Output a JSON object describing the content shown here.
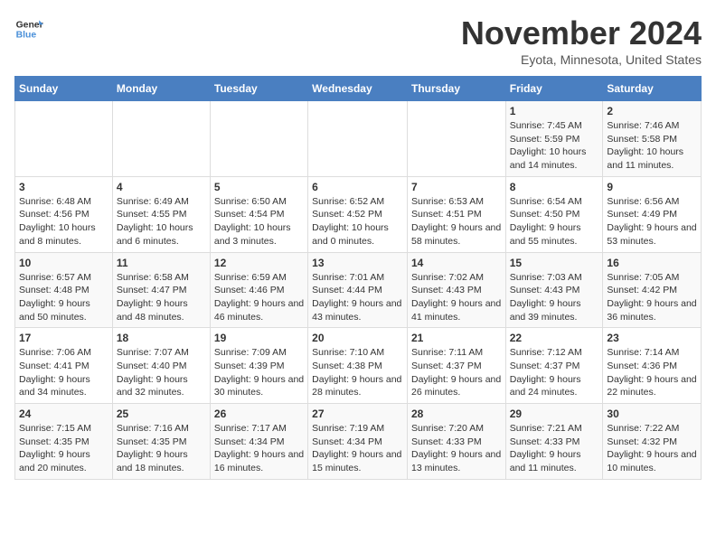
{
  "logo": {
    "general": "General",
    "blue": "Blue"
  },
  "header": {
    "month": "November 2024",
    "location": "Eyota, Minnesota, United States"
  },
  "weekdays": [
    "Sunday",
    "Monday",
    "Tuesday",
    "Wednesday",
    "Thursday",
    "Friday",
    "Saturday"
  ],
  "weeks": [
    [
      {
        "day": "",
        "info": ""
      },
      {
        "day": "",
        "info": ""
      },
      {
        "day": "",
        "info": ""
      },
      {
        "day": "",
        "info": ""
      },
      {
        "day": "",
        "info": ""
      },
      {
        "day": "1",
        "info": "Sunrise: 7:45 AM\nSunset: 5:59 PM\nDaylight: 10 hours and 14 minutes."
      },
      {
        "day": "2",
        "info": "Sunrise: 7:46 AM\nSunset: 5:58 PM\nDaylight: 10 hours and 11 minutes."
      }
    ],
    [
      {
        "day": "3",
        "info": "Sunrise: 6:48 AM\nSunset: 4:56 PM\nDaylight: 10 hours and 8 minutes."
      },
      {
        "day": "4",
        "info": "Sunrise: 6:49 AM\nSunset: 4:55 PM\nDaylight: 10 hours and 6 minutes."
      },
      {
        "day": "5",
        "info": "Sunrise: 6:50 AM\nSunset: 4:54 PM\nDaylight: 10 hours and 3 minutes."
      },
      {
        "day": "6",
        "info": "Sunrise: 6:52 AM\nSunset: 4:52 PM\nDaylight: 10 hours and 0 minutes."
      },
      {
        "day": "7",
        "info": "Sunrise: 6:53 AM\nSunset: 4:51 PM\nDaylight: 9 hours and 58 minutes."
      },
      {
        "day": "8",
        "info": "Sunrise: 6:54 AM\nSunset: 4:50 PM\nDaylight: 9 hours and 55 minutes."
      },
      {
        "day": "9",
        "info": "Sunrise: 6:56 AM\nSunset: 4:49 PM\nDaylight: 9 hours and 53 minutes."
      }
    ],
    [
      {
        "day": "10",
        "info": "Sunrise: 6:57 AM\nSunset: 4:48 PM\nDaylight: 9 hours and 50 minutes."
      },
      {
        "day": "11",
        "info": "Sunrise: 6:58 AM\nSunset: 4:47 PM\nDaylight: 9 hours and 48 minutes."
      },
      {
        "day": "12",
        "info": "Sunrise: 6:59 AM\nSunset: 4:46 PM\nDaylight: 9 hours and 46 minutes."
      },
      {
        "day": "13",
        "info": "Sunrise: 7:01 AM\nSunset: 4:44 PM\nDaylight: 9 hours and 43 minutes."
      },
      {
        "day": "14",
        "info": "Sunrise: 7:02 AM\nSunset: 4:43 PM\nDaylight: 9 hours and 41 minutes."
      },
      {
        "day": "15",
        "info": "Sunrise: 7:03 AM\nSunset: 4:43 PM\nDaylight: 9 hours and 39 minutes."
      },
      {
        "day": "16",
        "info": "Sunrise: 7:05 AM\nSunset: 4:42 PM\nDaylight: 9 hours and 36 minutes."
      }
    ],
    [
      {
        "day": "17",
        "info": "Sunrise: 7:06 AM\nSunset: 4:41 PM\nDaylight: 9 hours and 34 minutes."
      },
      {
        "day": "18",
        "info": "Sunrise: 7:07 AM\nSunset: 4:40 PM\nDaylight: 9 hours and 32 minutes."
      },
      {
        "day": "19",
        "info": "Sunrise: 7:09 AM\nSunset: 4:39 PM\nDaylight: 9 hours and 30 minutes."
      },
      {
        "day": "20",
        "info": "Sunrise: 7:10 AM\nSunset: 4:38 PM\nDaylight: 9 hours and 28 minutes."
      },
      {
        "day": "21",
        "info": "Sunrise: 7:11 AM\nSunset: 4:37 PM\nDaylight: 9 hours and 26 minutes."
      },
      {
        "day": "22",
        "info": "Sunrise: 7:12 AM\nSunset: 4:37 PM\nDaylight: 9 hours and 24 minutes."
      },
      {
        "day": "23",
        "info": "Sunrise: 7:14 AM\nSunset: 4:36 PM\nDaylight: 9 hours and 22 minutes."
      }
    ],
    [
      {
        "day": "24",
        "info": "Sunrise: 7:15 AM\nSunset: 4:35 PM\nDaylight: 9 hours and 20 minutes."
      },
      {
        "day": "25",
        "info": "Sunrise: 7:16 AM\nSunset: 4:35 PM\nDaylight: 9 hours and 18 minutes."
      },
      {
        "day": "26",
        "info": "Sunrise: 7:17 AM\nSunset: 4:34 PM\nDaylight: 9 hours and 16 minutes."
      },
      {
        "day": "27",
        "info": "Sunrise: 7:19 AM\nSunset: 4:34 PM\nDaylight: 9 hours and 15 minutes."
      },
      {
        "day": "28",
        "info": "Sunrise: 7:20 AM\nSunset: 4:33 PM\nDaylight: 9 hours and 13 minutes."
      },
      {
        "day": "29",
        "info": "Sunrise: 7:21 AM\nSunset: 4:33 PM\nDaylight: 9 hours and 11 minutes."
      },
      {
        "day": "30",
        "info": "Sunrise: 7:22 AM\nSunset: 4:32 PM\nDaylight: 9 hours and 10 minutes."
      }
    ]
  ]
}
